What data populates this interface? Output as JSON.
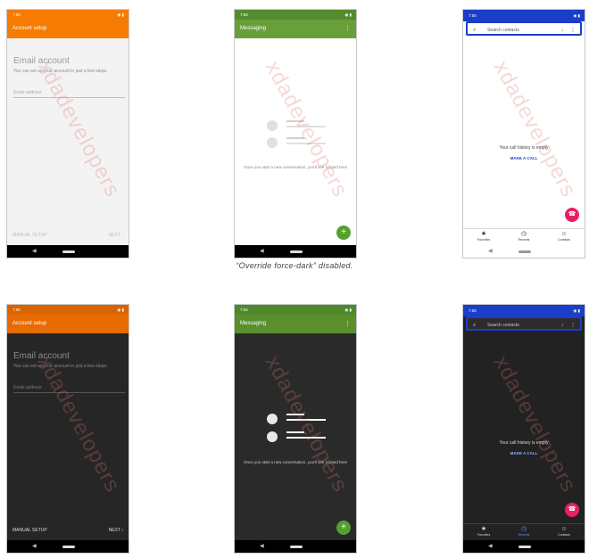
{
  "watermark": "xdadevelopers",
  "caption": "“Override force-dark” disabled.",
  "statusbar": {
    "time": "7:55",
    "icons": "◉ ▮"
  },
  "account": {
    "title": "Account setup",
    "heading": "Email account",
    "subtitle": "You can set up your account in just a few steps.",
    "placeholder": "Email address",
    "manual": "MANUAL SETUP",
    "next": "NEXT",
    "next_arrow": "›"
  },
  "messaging": {
    "title": "Messaging",
    "menu": "⋮",
    "empty": "Once you start a new conversation, you'll see it listed here",
    "fab": "+"
  },
  "contacts": {
    "search_placeholder": "Search contacts",
    "search_icon": "⌕",
    "mic_icon": "♩",
    "menu": "⋮",
    "empty": "Your call history is empty",
    "make_call": "MAKE A CALL",
    "nav": [
      {
        "label": "Favorites",
        "icon": "★"
      },
      {
        "label": "Recents",
        "icon": "◷"
      },
      {
        "label": "Contacts",
        "icon": "☺"
      }
    ]
  },
  "nav": {
    "back": "◀"
  },
  "colors": {
    "account_light_bar": "#f57c00",
    "account_dark_bar": "#e66b00",
    "messaging_light_bar": "#689f38",
    "messaging_dark_bar": "#5a8f2e",
    "contacts_bar": "#1a3ec8",
    "fab_green": "#55a02b",
    "fab_pink": "#e91e63",
    "dark_bg": "#2a2a2a",
    "light_bg": "#f2f2f2"
  }
}
